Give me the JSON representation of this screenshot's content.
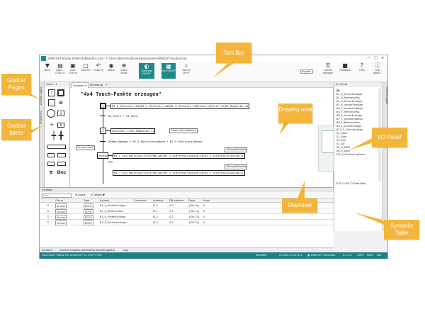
{
  "window": {
    "title": "GRAFCET-Studio (lifePortaNow-PLC-Lab - C:\\Users\\ben\\OneDrive\\Dokumente\\GRAFCET-Studio\\clie)",
    "controls": [
      "—",
      "□",
      "✕"
    ]
  },
  "toolbar": {
    "buttons": [
      {
        "label": "Menu",
        "icon": "menu-icon",
        "glyph": "▼"
      },
      {
        "label": "Open... CTRL+O",
        "icon": "open-folder-icon",
        "glyph": "▤"
      },
      {
        "label": "Save CTRL+S",
        "icon": "save-icon",
        "glyph": "▣"
      },
      {
        "label": "New F8",
        "icon": "new-icon",
        "glyph": "□"
      },
      {
        "label": "Undo F2",
        "icon": "undo-icon",
        "glyph": "↶"
      },
      {
        "label": "Watch",
        "icon": "watch-icon",
        "glyph": "◉"
      },
      {
        "label": "Zoom on/off",
        "icon": "zoom-icon",
        "glyph": "⊕"
      },
      {
        "label": "Overview ON/OFF",
        "icon": "overview-icon",
        "glyph": "◐"
      },
      {
        "label": "Grid ON/OFF",
        "icon": "grid-icon",
        "glyph": "▦"
      },
      {
        "label": "Search Ctrl+F",
        "icon": "search-icon",
        "glyph": "⌕"
      }
    ],
    "language": "English",
    "right_buttons": [
      {
        "label": "License manager",
        "icon": "key-icon",
        "glyph": "⚿"
      },
      {
        "label": "Feedback",
        "icon": "feedback-icon",
        "glyph": "■"
      },
      {
        "label": "Help",
        "icon": "help-icon",
        "glyph": "?"
      },
      {
        "label": "Info about...",
        "icon": "info-icon",
        "glyph": "ⓘ"
      }
    ]
  },
  "left_tabs": [
    "Grafcet pages",
    "Properties"
  ],
  "palette": {
    "header": "Graft... ▾",
    "items": [
      "step",
      "initial-step",
      "transition",
      "action",
      "macro-step",
      "text",
      "doc"
    ],
    "labels": {
      "t": "T",
      "doc": "Doc",
      "s": "S"
    }
  },
  "canvas": {
    "tabs": [
      {
        "label": "Beispiel ✕",
        "active": true
      },
      {
        "label": "Einleitung",
        "active": false
      },
      {
        "label": "+",
        "active": false
      }
    ],
    "title": "\"4x4 Touch-Punkte erzeugen\"",
    "steps": [
      {
        "num": "1",
        "actions": [
          "M1_A_Velocity:=60",
          "M2_V_Velocity:=60",
          "M1_Z_Velocity:=60",
          "CntX:=0",
          "CntY:=0",
          "M1_MagnetOn:=0"
        ]
      },
      {
        "num": "2",
        "actions": [
          "GoFarmer:=1",
          "M1_MagnetOn:=1"
        ]
      },
      {
        "num": "SchleifeX",
        "actions": [
          "M1_X_SollPosition:=CntX*80)+60",
          "M1_X_StartPositioning:=0",
          "M1_X_StartPositioning:=1"
        ]
      },
      {
        "num": "",
        "actions": [
          "M1_Y_SollPosition:=CntY*80)+60",
          "M1_Y_StartPositioning:=0",
          "M1_Y_StartPositioning:=1"
        ]
      }
    ],
    "transitions": [
      "M1_Start * S4_Auto",
      "500ms/Agomme * M1_X_PositioningDone * M1_Y_PositioningDone"
    ],
    "notes": [
      "\"Home Pos anfahren\"",
      "\"X und Y Pos\"",
      "100ms/XSchleife",
      "100ms/XSchleife"
    ]
  },
  "io_panel": {
    "title": "I/O-Panel",
    "section": "DI",
    "items": [
      "B1_X_HinterEndlage",
      "B1_A_ReferenzPos",
      "B1_X_HinterEndlage",
      "B1_X_VorderEndlage",
      "B4_Y_VorderEndlage",
      "B5_Y_ReferenzPos",
      "B6_Y_HinterEndlage",
      "B7_Y_VorderEndlage",
      "B8_Z_ReferenzPos",
      "B9_Z_UnterEndlage",
      "B10_Z_ObenEndlage",
      "S1_Start",
      "S2_Stop",
      "S3_ACK",
      "S4_AIF",
      "S5_Z_MAN",
      "S6_Z_Auto",
      "M1_X_PositioningDone"
    ],
    "footer": [
      "DI",
      "DO",
      "Data Bool"
    ]
  },
  "symbols": {
    "header": "Symbols",
    "filter_placeholder": "Filter",
    "insert_label": "Insert",
    "delete_label": "Delete",
    "columns": [
      "Group",
      "Type",
      "Symbol",
      "Comment",
      "Address",
      "DB address",
      "Flags",
      "Used"
    ],
    "rows": [
      {
        "group": "Sensor",
        "type": "BOOL",
        "symbol": "B1_X_HinterEndlage",
        "address": "I0.0",
        "db": "0.0",
        "flags": "{(5h.0)}",
        "used": "0"
      },
      {
        "group": "Sensor",
        "type": "BOOL",
        "symbol": "B2_X_ReferenzPos",
        "address": "I0.1",
        "db": "0.1",
        "flags": "{(5h.1)}",
        "used": "0"
      },
      {
        "group": "Sensor",
        "type": "BOOL",
        "symbol": "B3_X_HinterEndlage",
        "address": "I0.2",
        "db": "0.2",
        "flags": "{(5h.2)}",
        "used": "0"
      },
      {
        "group": "Sensor",
        "type": "BOOL",
        "symbol": "B4_X_VorderEndlage",
        "address": "I0.3",
        "db": "0.3",
        "flags": "{(5h.3)}",
        "used": "0"
      }
    ]
  },
  "bottom_tabs": [
    "Symbols",
    "Grafcet snippets (Default\\Grafcet\\Snippets)",
    "Log"
  ],
  "statusbar": {
    "left": "Command \"Home Pos anfahren\" X=176 Y=194",
    "modified": "Modified",
    "coords": "X=400,0  Y=171,2",
    "sim": "GRAFCET Simulator",
    "version": "2.0.0.0",
    "right": [
      "CAPS",
      "NUM",
      "INS"
    ]
  },
  "callouts": {
    "tool_bar": "Tool Bar",
    "grafcet_pages": "Grafcet Pages",
    "grafcet_items": "Grafcet Items",
    "drawing_area": "Drawing area",
    "io_panel": "I/O Panel",
    "overview": "Overview",
    "symbolic_table": "Symbolic Table"
  },
  "colors": {
    "accent": "#1e8a8a",
    "callout": "#f3b63b",
    "statusbar": "#1e7f86"
  }
}
